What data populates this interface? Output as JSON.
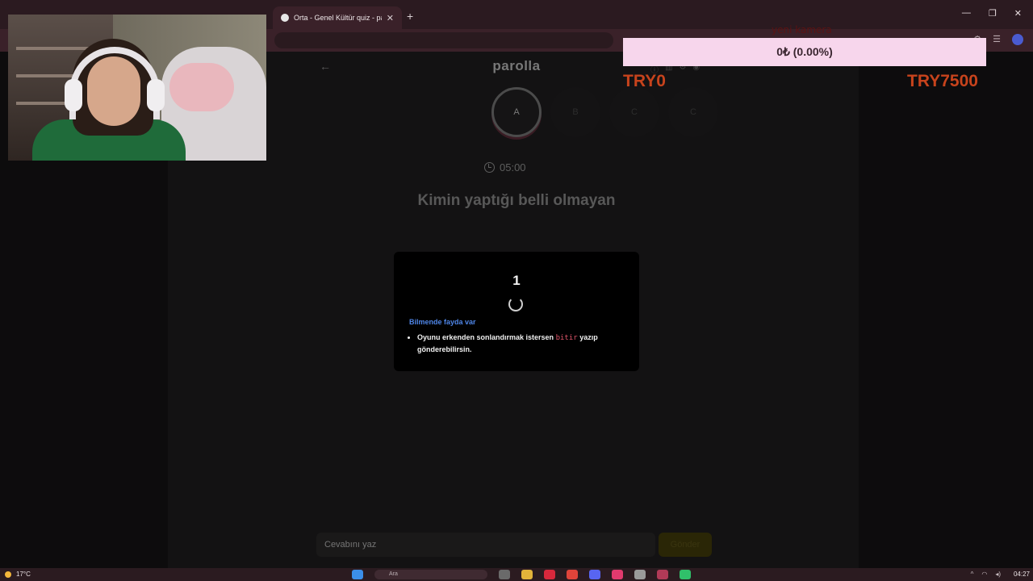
{
  "browser": {
    "tabs": [
      {
        "title": "Orta - Genel Kültür quiz - parolla",
        "active": true
      }
    ],
    "new_tab": "+",
    "close_tab": "✕",
    "window_controls": [
      "—",
      "❐",
      "✕"
    ]
  },
  "page": {
    "brand": "parolla",
    "back": "←",
    "players": [
      "A",
      "B",
      "C",
      "C"
    ],
    "timer": "05:00",
    "question": "Kimin yaptığı belli olmayan",
    "card": {
      "countdown": "1",
      "tip_title": "Bilmende fayda var",
      "tip_text_before": "Oyunu erkenden sonlandırmak istersen",
      "tip_keyword": "bitir",
      "tip_text_after": "yazıp gönderebilirsin."
    },
    "answer_placeholder": "Cevabını yaz",
    "send_label": "Gönder"
  },
  "overlay": {
    "donation_title": "yeni kamera",
    "donation_progress": "0₺ (0.00%)",
    "donation_fraction": 0.0,
    "goal_min": "TRY0",
    "goal_max": "TRY7500"
  },
  "taskbar": {
    "weather": "17°C",
    "search_placeholder": "Ara",
    "clock": "04:27"
  },
  "colors": {
    "accent_blue": "#4f86e8",
    "keyword_red": "#e0556a",
    "goal_orange": "#c7431c",
    "donation_bg": "#f7d6ec"
  }
}
